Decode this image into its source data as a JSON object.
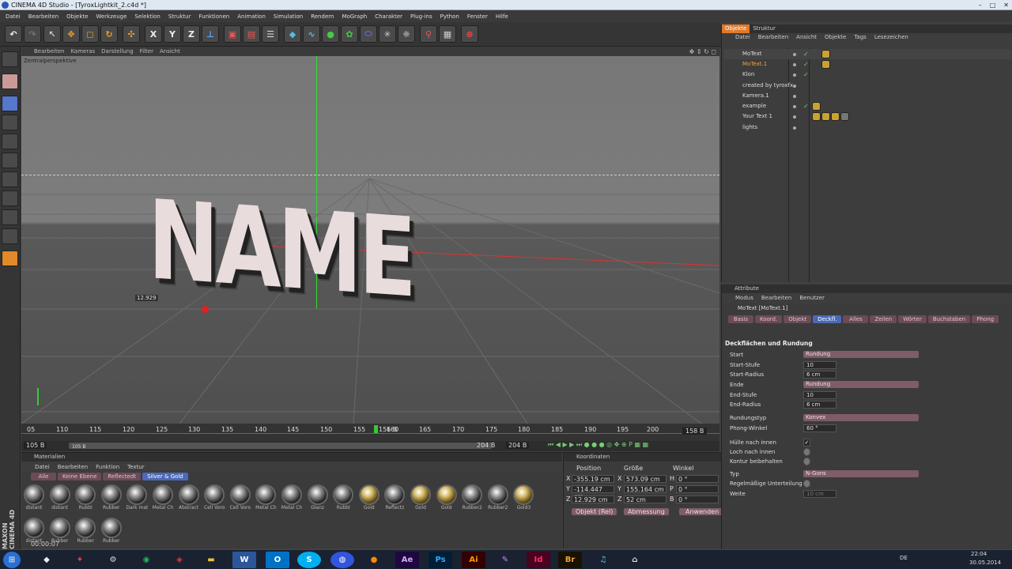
{
  "window": {
    "title": "CINEMA 4D Studio - [TyroxLightkit_2.c4d *]",
    "controls": [
      "–",
      "□",
      "✕"
    ]
  },
  "menu": [
    "Datei",
    "Bearbeiten",
    "Objekte",
    "Werkzeuge",
    "Selektion",
    "Struktur",
    "Funktionen",
    "Animation",
    "Simulation",
    "Rendern",
    "MoGraph",
    "Charakter",
    "Plug-ins",
    "Python",
    "Fenster",
    "Hilfe"
  ],
  "toolbar": {
    "x": "X",
    "y": "Y",
    "z": "Z"
  },
  "viewport": {
    "menu": [
      "Bearbeiten",
      "Kameras",
      "Darstellung",
      "Filter",
      "Ansicht"
    ],
    "label": "Zentralperspektive",
    "scene_text": "NAME",
    "readout": "12.929"
  },
  "timeline": {
    "ticks": [
      "05",
      "110",
      "115",
      "120",
      "125",
      "130",
      "135",
      "140",
      "145",
      "150",
      "155",
      "160",
      "165",
      "170",
      "175",
      "180",
      "185",
      "190",
      "195",
      "200"
    ],
    "current": "156 B",
    "end": "158 B"
  },
  "timebar": {
    "start": "105 B",
    "start2": "105 B",
    "end1": "204 B",
    "end2": "204 B"
  },
  "materials": {
    "header": "Materialien",
    "menu": [
      "Datei",
      "Bearbeiten",
      "Funktion",
      "Textur"
    ],
    "filters": [
      "Alle",
      "Keine Ebene",
      "Reflectedt",
      "Silver & Gold"
    ],
    "items": [
      "distant",
      "distant",
      "Rubbl",
      "Rubber",
      "Dark mat",
      "Metal Ch",
      "Abstract",
      "Cell Voro",
      "Cell Voro",
      "Metal Ch",
      "Metal Ch",
      "Glanz",
      "Rubbl",
      "Gold",
      "Reflectz",
      "Gold",
      "Gold",
      "Rubber2",
      "Rubber2",
      "Gold3",
      "distant",
      "Rubber",
      "Rubber",
      "Rubber"
    ],
    "time": "00:00:07"
  },
  "coords": {
    "header": "Koordinaten",
    "cols": [
      "Position",
      "Größe",
      "Winkel"
    ],
    "rows": [
      {
        "a": "X",
        "p": "-355.19 cm",
        "s": "573.09 cm",
        "w": "H",
        "wv": "0 °"
      },
      {
        "a": "Y",
        "p": "-114.447 cm",
        "s": "155.164 cm",
        "w": "P",
        "wv": "0 °"
      },
      {
        "a": "Z",
        "p": "12.929 cm",
        "s": "52 cm",
        "w": "B",
        "wv": "0 °"
      }
    ],
    "mode1": "Objekt (Rel)",
    "mode2": "Abmessung",
    "apply": "Anwenden"
  },
  "objects": {
    "tabs": [
      "Objekte",
      "Struktur"
    ],
    "menu": [
      "Datei",
      "Bearbeiten",
      "Ansicht",
      "Objekte",
      "Tags",
      "Lesezeichen"
    ],
    "items": [
      "MoText",
      "MoText.1",
      "Klon",
      "created by tyroxfx",
      "Kamera.1",
      "example",
      "Your Text 1",
      "lights"
    ]
  },
  "attributes": {
    "header": "Attribute",
    "menu": [
      "Modus",
      "Bearbeiten",
      "Benutzer"
    ],
    "object": "MoText [MoText.1]",
    "tabs": [
      "Basis",
      "Koord.",
      "Objekt",
      "Deckfl.",
      "Alles",
      "Zeilen",
      "Wörter",
      "Buchstaben",
      "Phong"
    ],
    "section": "Deckflächen und Rundung",
    "fields": {
      "start_l": "Start",
      "start_v": "Rundung",
      "ststufe_l": "Start-Stufe",
      "ststufe_v": "10",
      "strad_l": "Start-Radius",
      "strad_v": "6 cm",
      "ende_l": "Ende",
      "ende_v": "Rundung",
      "endstufe_l": "End-Stufe",
      "endstufe_v": "10",
      "endrad_l": "End-Radius",
      "endrad_v": "6 cm",
      "rtyp_l": "Rundungstyp",
      "rtyp_v": "Konvex",
      "phong_l": "Phong-Winkel",
      "phong_v": "60 °",
      "huelle_l": "Hülle nach innen",
      "loch_l": "Loch nach innen",
      "kontur_l": "Kontur beibehalten",
      "typ_l": "Typ",
      "typ_v": "N-Gons",
      "regel_l": "Regelmäßige Unterteilung",
      "weite_l": "Weite",
      "weite_v": "10 cm"
    }
  },
  "taskbar": {
    "apps": [
      "Ae",
      "Ps",
      "Ai",
      "Id",
      "Br"
    ],
    "lang": "DE",
    "time": "22:04",
    "date": "30.05.2014"
  },
  "brand": "MAXON CINEMA 4D"
}
